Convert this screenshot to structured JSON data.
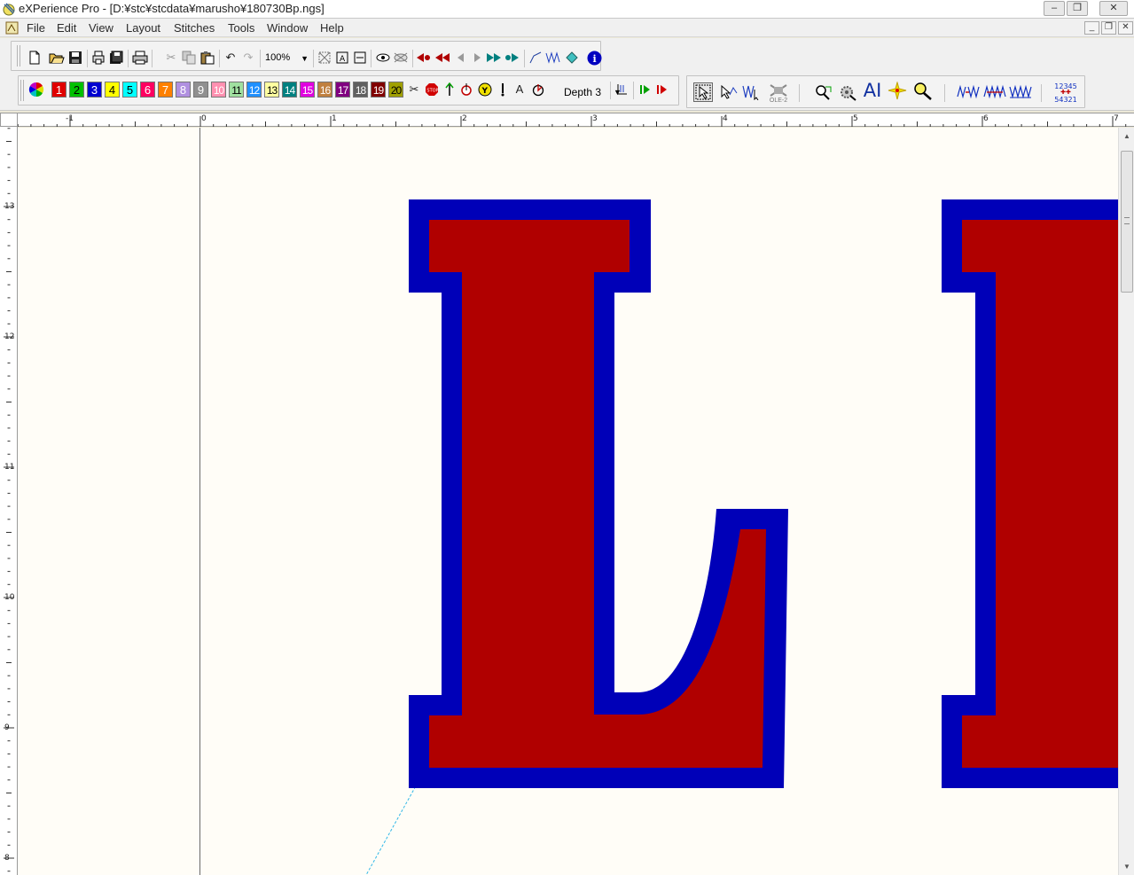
{
  "window": {
    "title": "eXPerience Pro - [D:¥stc¥stcdata¥marusho¥180730Bp.ngs]",
    "minimize_glyph": "–",
    "restore_glyph": "❐",
    "close_glyph": "✕"
  },
  "menubar": {
    "items": [
      "File",
      "Edit",
      "View",
      "Layout",
      "Stitches",
      "Tools",
      "Window",
      "Help"
    ],
    "mdi_minimize": "_",
    "mdi_restore": "❐",
    "mdi_close": "✕"
  },
  "toolbar": {
    "zoom_value": "100%",
    "zoom_arrow": "▼",
    "depth_value": "Depth 3",
    "depth_arrow": "▼",
    "ole_label": "OLE-2",
    "text_tool_label": "AI",
    "font_tool_label": "A",
    "numbers_top": "12345",
    "numbers_bottom": "54321"
  },
  "colors": {
    "accent_red": "#b00000",
    "accent_blue": "#0000b8",
    "canvas_bg": "#fffdf7",
    "swatches": [
      {
        "label": "1",
        "bg": "#e00000",
        "fg": "#ffffff"
      },
      {
        "label": "2",
        "bg": "#00c000",
        "fg": "#000000"
      },
      {
        "label": "3",
        "bg": "#0000d0",
        "fg": "#ffffff"
      },
      {
        "label": "4",
        "bg": "#ffff00",
        "fg": "#000000"
      },
      {
        "label": "5",
        "bg": "#00ffff",
        "fg": "#000000"
      },
      {
        "label": "6",
        "bg": "#ff0060",
        "fg": "#ffffff"
      },
      {
        "label": "7",
        "bg": "#ff8000",
        "fg": "#ffffff"
      },
      {
        "label": "8",
        "bg": "#b090e0",
        "fg": "#ffffff"
      },
      {
        "label": "9",
        "bg": "#909090",
        "fg": "#ffffff"
      },
      {
        "label": "10",
        "bg": "#ff90b0",
        "fg": "#ffffff"
      },
      {
        "label": "11",
        "bg": "#a0e0a0",
        "fg": "#000000"
      },
      {
        "label": "12",
        "bg": "#2090ff",
        "fg": "#ffffff"
      },
      {
        "label": "13",
        "bg": "#ffffa0",
        "fg": "#000000"
      },
      {
        "label": "14",
        "bg": "#008080",
        "fg": "#ffffff"
      },
      {
        "label": "15",
        "bg": "#e000e0",
        "fg": "#ffffff"
      },
      {
        "label": "16",
        "bg": "#c08040",
        "fg": "#ffffff"
      },
      {
        "label": "17",
        "bg": "#800080",
        "fg": "#ffffff"
      },
      {
        "label": "18",
        "bg": "#606060",
        "fg": "#ffffff"
      },
      {
        "label": "19",
        "bg": "#800000",
        "fg": "#ffffff"
      },
      {
        "label": "20",
        "bg": "#a0a000",
        "fg": "#000000"
      }
    ]
  },
  "rulers": {
    "horizontal_labels": [
      "-1",
      "0",
      "1",
      "2",
      "3",
      "4",
      "5",
      "6",
      "7"
    ],
    "vertical_labels": [
      "13",
      "12",
      "11",
      "10",
      "9",
      "8"
    ]
  },
  "icons": {
    "toolbar1": [
      "new-file-icon",
      "open-folder-icon",
      "save-icon",
      "print-setup-icon",
      "save-all-icon",
      "print-icon",
      "cut-icon",
      "copy-icon",
      "paste-icon",
      "undo-icon",
      "redo-icon",
      "fit-design-icon",
      "zoom-box-icon",
      "zoom-width-icon",
      "show-stitches-icon",
      "hide-stitches-icon",
      "first-stitch-icon",
      "prev-color-icon",
      "prev-stitch-icon",
      "next-stitch-icon",
      "next-color-icon",
      "last-stitch-icon",
      "line-tool-icon",
      "stitch-tool-icon",
      "fill-tool-icon",
      "info-icon"
    ],
    "toolbar2": [
      "color-wheel-icon",
      "trim-icon",
      "stop-icon",
      "needle-up-icon",
      "tie-icon",
      "tie-off-icon",
      "needle-icon",
      "font-icon",
      "depth-icon",
      "select-icon",
      "play-icon",
      "stop-play-icon",
      "pointer-icon",
      "node-edit-icon",
      "stitch-edit-icon",
      "ole-icon",
      "zoom-in-icon",
      "settings-icon",
      "text-tool-icon",
      "sparkle-icon",
      "magnify-icon",
      "pattern-a-icon",
      "pattern-b-icon",
      "pattern-c-icon",
      "numbers-icon"
    ]
  }
}
